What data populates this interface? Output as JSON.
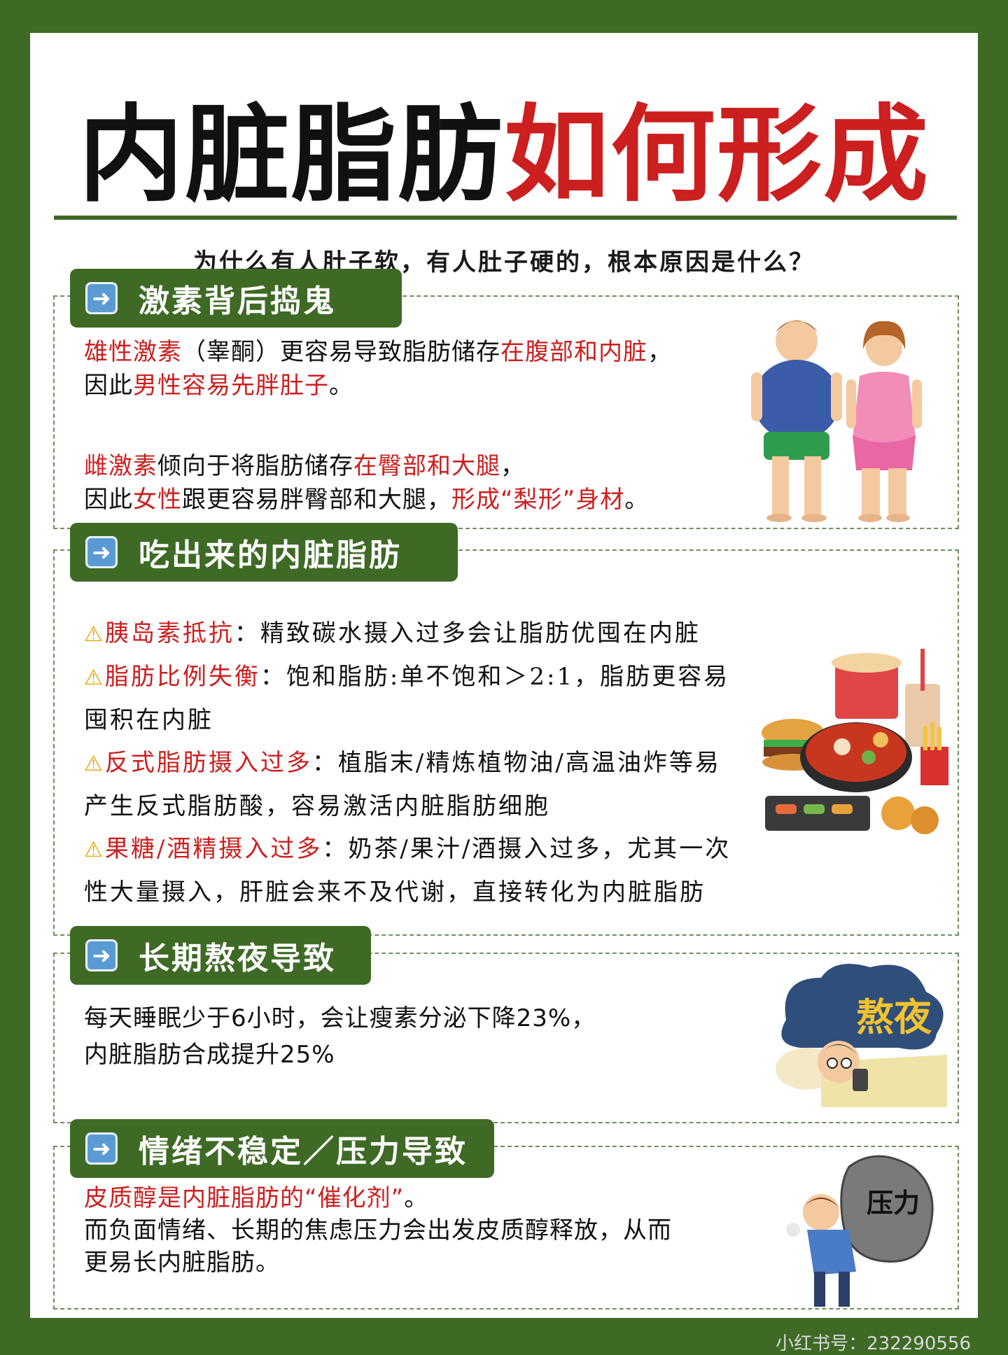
{
  "title": {
    "part1": "内脏脂肪",
    "part2": "如何形成"
  },
  "subtitle": "为什么有人肚子软，有人肚子硬的，根本原因是什么？",
  "colors": {
    "frame_green": "#3f6a26",
    "accent_red": "#cc1f1f",
    "icon_blue": "#5b9bd5"
  },
  "sections": [
    {
      "icon": "arrow-right-icon",
      "heading": "激素背后捣鬼",
      "illustration": "overweight-man-and-woman",
      "p1": {
        "a": "雄性激素",
        "b": "（睾酮）更容易导致脂肪储存",
        "c": "在腹部和内脏",
        "d": "，",
        "e": "因此",
        "f": "男性容易先胖肚子",
        "g": "。"
      },
      "p2": {
        "a": "雌激素",
        "b": "倾向于将脂肪储存",
        "c": "在臀部和大腿",
        "d": "，",
        "e": "因此",
        "f": "女性",
        "g": "跟更容易胖臀部和大腿，",
        "h": "形成“梨形”身材",
        "i": "。"
      }
    },
    {
      "icon": "arrow-right-icon",
      "heading": "吃出来的内脏脂肪",
      "illustration": "junk-food-pile",
      "items": [
        {
          "icon": "warning-icon",
          "term": "胰岛素抵抗",
          "line1": "：精致碳水摄入过多会让脂肪优囤在内脏",
          "line2": ""
        },
        {
          "icon": "warning-icon",
          "term": "脂肪比例失衡",
          "line1": "：饱和脂肪:单不饱和＞2:1，脂肪更容易",
          "line2": "囤积在内脏"
        },
        {
          "icon": "warning-icon",
          "term": "反式脂肪摄入过多",
          "line1": "：植脂末/精炼植物油/高温油炸等易",
          "line2": "产生反式脂肪酸，容易激活内脏脂肪细胞"
        },
        {
          "icon": "warning-icon",
          "term": "果糖/酒精摄入过多",
          "line1": "：奶茶/果汁/酒摄入过多，尤其一次",
          "line2": "性大量摄入，肝脏会来不及代谢，直接转化为内脏脂肪"
        }
      ]
    },
    {
      "icon": "arrow-right-icon",
      "heading": "长期熬夜导致",
      "illustration": "staying-up-late",
      "illustration_text": "熬夜",
      "lines": [
        "每天睡眠少于6小时，会让瘦素分泌下降23%，",
        "内脏脂肪合成提升25%"
      ]
    },
    {
      "icon": "arrow-right-icon",
      "heading": "情绪不稳定／压力导致",
      "illustration": "man-carrying-stress-rock",
      "illustration_text": "压力",
      "line1": {
        "a": "皮质醇是内脏脂肪的“催化剂”",
        "b": "。"
      },
      "line2": "而负面情绪、长期的焦虑压力会出发皮质醇释放，从而",
      "line3": "更易长内脏脂肪。"
    }
  ],
  "watermark": "小红书号：232290556"
}
